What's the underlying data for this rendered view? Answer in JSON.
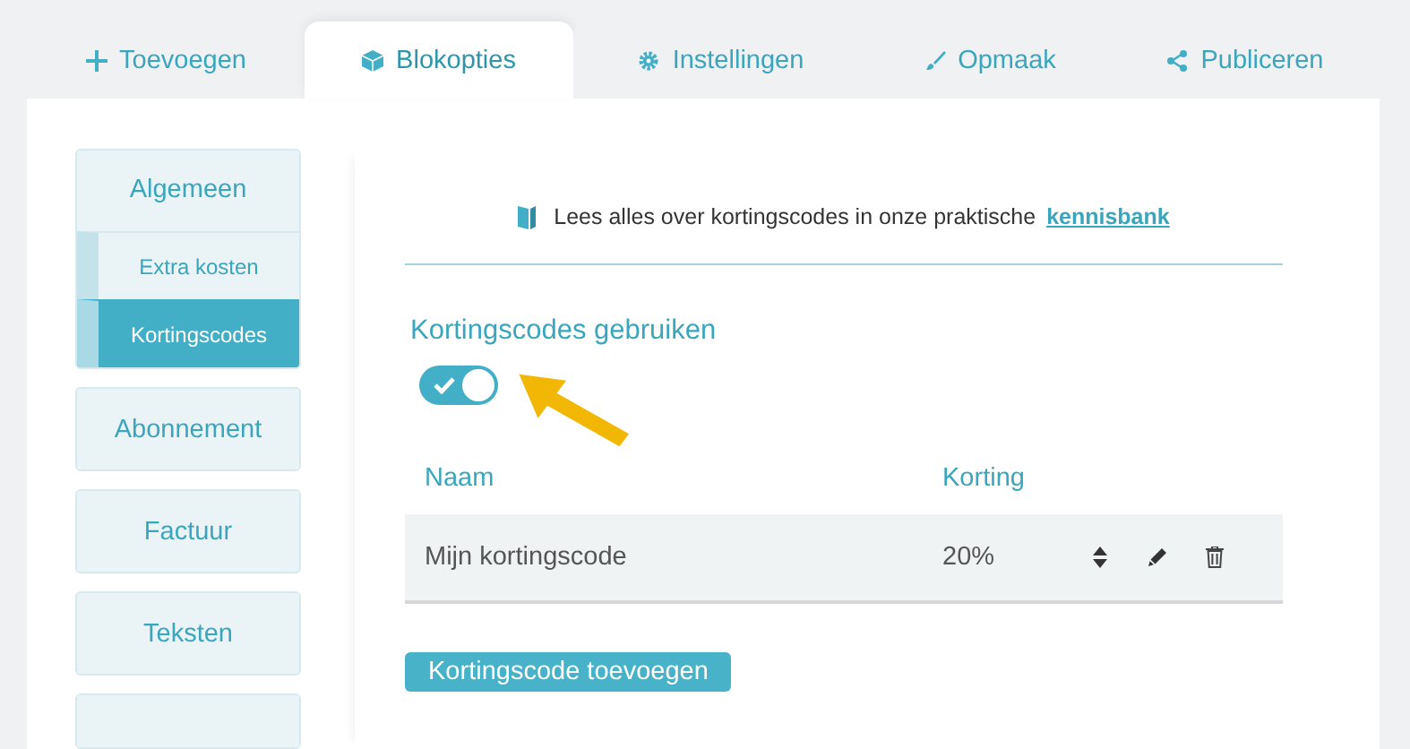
{
  "tabs": [
    {
      "label": "Toevoegen",
      "selected": false
    },
    {
      "label": "Blokopties",
      "selected": true
    },
    {
      "label": "Instellingen",
      "selected": false
    },
    {
      "label": "Opmaak",
      "selected": false
    },
    {
      "label": "Publiceren",
      "selected": false
    }
  ],
  "sidebar": {
    "items": [
      {
        "label": "Algemeen",
        "selected": false,
        "children": [
          {
            "label": "Extra kosten",
            "selected": false
          },
          {
            "label": "Kortingscodes",
            "selected": true
          }
        ]
      },
      {
        "label": "Abonnement",
        "selected": false
      },
      {
        "label": "Factuur",
        "selected": false
      },
      {
        "label": "Teksten",
        "selected": false
      }
    ]
  },
  "info": {
    "text": "Lees alles over kortingscodes in onze praktische",
    "link": "kennisbank"
  },
  "setting": {
    "label": "Kortingscodes gebruiken",
    "on": true
  },
  "table": {
    "columns": [
      "Naam",
      "Korting"
    ],
    "rows": [
      {
        "name": "Mijn kortingscode",
        "discount": "20%"
      }
    ]
  },
  "add_button": "Kortingscode toevoegen"
}
